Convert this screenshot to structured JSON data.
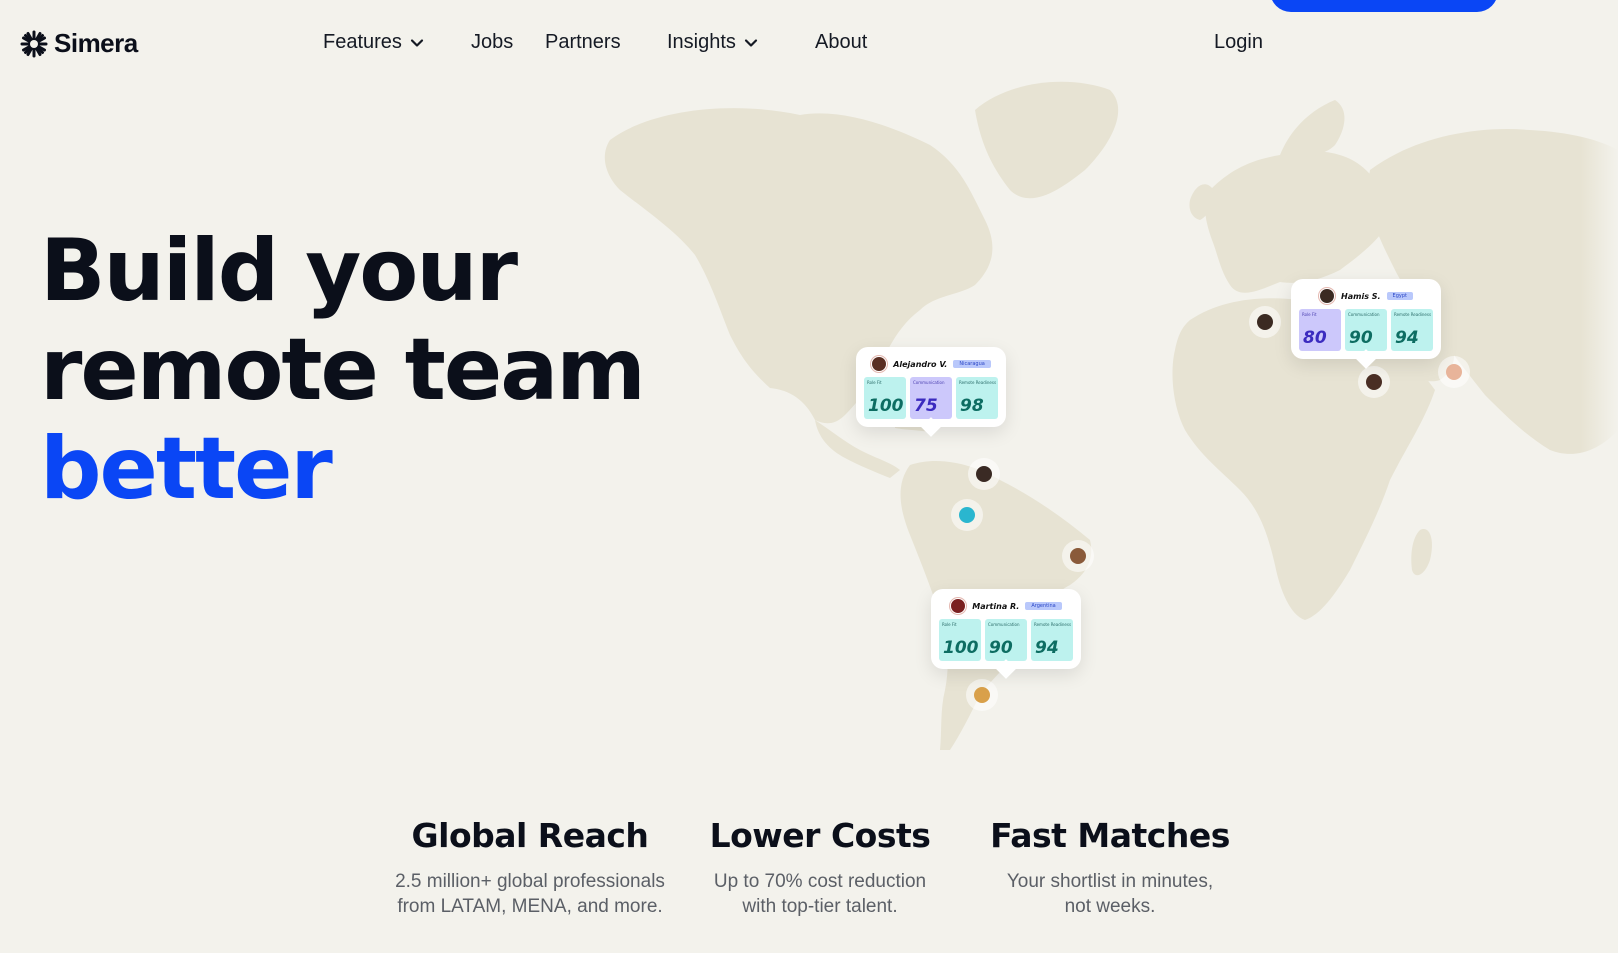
{
  "brand": {
    "name": "Simera",
    "logo_icon": "snowflake-asterisk-icon",
    "accent": "#0a46f5"
  },
  "nav": {
    "items": [
      {
        "label": "Features",
        "has_dropdown": true
      },
      {
        "label": "Jobs",
        "has_dropdown": false
      },
      {
        "label": "Partners",
        "has_dropdown": false
      },
      {
        "label": "Insights",
        "has_dropdown": true
      },
      {
        "label": "About",
        "has_dropdown": false
      }
    ],
    "login": "Login"
  },
  "hero": {
    "line1": "Build your",
    "line2": "remote team",
    "line3": "better"
  },
  "cards": [
    {
      "name": "Alejandro V.",
      "flag": "Nicaragua",
      "scores": [
        {
          "label": "Role Fit",
          "value": "100"
        },
        {
          "label": "Communication",
          "value": "75"
        },
        {
          "label": "Remote Readiness",
          "value": "98"
        }
      ]
    },
    {
      "name": "Hamis S.",
      "flag": "Egypt",
      "scores": [
        {
          "label": "Role Fit",
          "value": "80"
        },
        {
          "label": "Communication",
          "value": "90"
        },
        {
          "label": "Remote Readiness",
          "value": "94"
        }
      ]
    },
    {
      "name": "Martina R.",
      "flag": "Argentina",
      "scores": [
        {
          "label": "Role Fit",
          "value": "100"
        },
        {
          "label": "Communication",
          "value": "90"
        },
        {
          "label": "Remote Readiness",
          "value": "94"
        }
      ]
    }
  ],
  "features": [
    {
      "title": "Global Reach",
      "line1": "2.5 million+ global professionals",
      "line2": "from LATAM, MENA, and more."
    },
    {
      "title": "Lower Costs",
      "line1": "Up to 70% cost reduction",
      "line2": "with top-tier talent."
    },
    {
      "title": "Fast Matches",
      "line1": "Your shortlist in minutes,",
      "line2": "not weeks."
    }
  ]
}
